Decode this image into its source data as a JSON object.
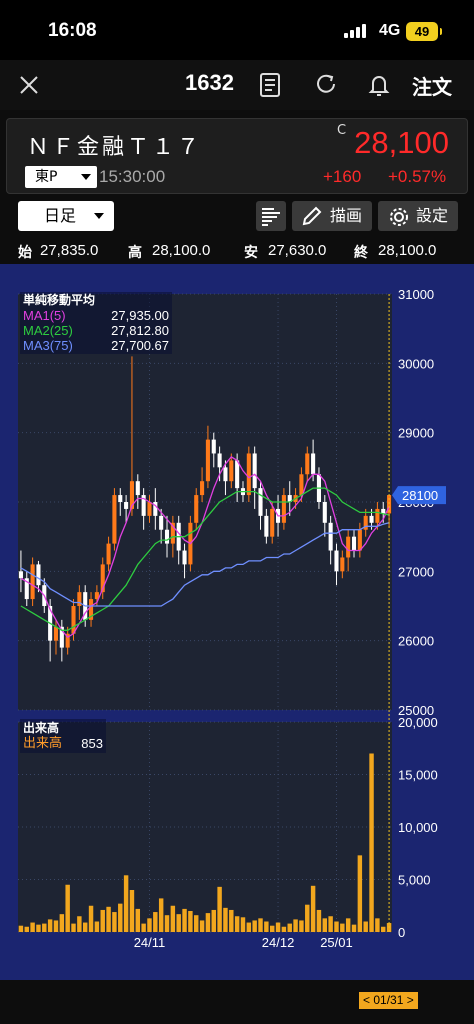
{
  "status_bar": {
    "time": "16:08",
    "network": "4G",
    "battery": "49"
  },
  "nav": {
    "ticker": "1632",
    "order_label": "注文"
  },
  "quote": {
    "name": "ＮＦ金融Ｔ１７",
    "market": "東P",
    "time": "15:30:00",
    "price_flag": "C",
    "price": "28,100",
    "change": "+160",
    "change_pct": "+0.57%"
  },
  "toolbar": {
    "period": "日足",
    "draw_label": "描画",
    "settings_label": "設定"
  },
  "ohlc": {
    "open_label": "始",
    "open": "27,835.0",
    "high_label": "高",
    "high": "28,100.0",
    "low_label": "安",
    "low": "27,630.0",
    "close_label": "終",
    "close": "28,100.0"
  },
  "price_legend": {
    "title": "単純移動平均",
    "items": [
      {
        "label": "MA1(5)",
        "value": "27,935.00",
        "color": "#e040e0"
      },
      {
        "label": "MA2(25)",
        "value": "27,812.80",
        "color": "#2ecc40"
      },
      {
        "label": "MA3(75)",
        "value": "27,700.67",
        "color": "#6f8fff"
      }
    ]
  },
  "volume_legend": {
    "title": "出来高",
    "label": "出来高",
    "value": "853"
  },
  "current_price_label": "28100",
  "current_date_label": "< 01/31 >",
  "colors": {
    "up": "#ff7a1a",
    "down": "#ffffff",
    "chart_bg": "#1b2570",
    "plot_bg": "#1e2433",
    "volume": "#f2a71e"
  },
  "chart_data": [
    {
      "type": "candlestick",
      "title": "単純移動平均",
      "y_ticks": [
        25000,
        26000,
        27000,
        28000,
        29000,
        30000,
        31000
      ],
      "y_tick_labels": [
        "25000",
        "26000",
        "27000",
        "28000",
        "29000",
        "30000",
        "31000"
      ],
      "ylim": [
        25000,
        31000
      ],
      "x_labels": [
        "24/11",
        "24/12",
        "25/01"
      ],
      "candles": [
        [
          27000,
          26900,
          27300,
          26700
        ],
        [
          26900,
          26600,
          27000,
          26500
        ],
        [
          26600,
          27100,
          27200,
          26500
        ],
        [
          27100,
          26800,
          27150,
          26700
        ],
        [
          26800,
          26500,
          26900,
          26400
        ],
        [
          26500,
          26000,
          26600,
          25700
        ],
        [
          26000,
          26200,
          26300,
          25800
        ],
        [
          26200,
          25900,
          26300,
          25700
        ],
        [
          25900,
          26100,
          26200,
          25800
        ],
        [
          26100,
          26500,
          26600,
          26000
        ],
        [
          26500,
          26700,
          26800,
          26300
        ],
        [
          26700,
          26300,
          26800,
          26200
        ],
        [
          26300,
          26600,
          26700,
          26200
        ],
        [
          26600,
          26700,
          26800,
          26500
        ],
        [
          26700,
          27100,
          27200,
          26600
        ],
        [
          27100,
          27400,
          27500,
          27000
        ],
        [
          27400,
          28100,
          28200,
          27300
        ],
        [
          28100,
          28000,
          28200,
          27800
        ],
        [
          28000,
          27900,
          28100,
          27700
        ],
        [
          27900,
          28300,
          30100,
          27800
        ],
        [
          28300,
          28100,
          28400,
          27900
        ],
        [
          28100,
          27800,
          28200,
          27600
        ],
        [
          27800,
          28000,
          28100,
          27700
        ],
        [
          28000,
          27800,
          28200,
          27600
        ],
        [
          27800,
          27600,
          27900,
          27400
        ],
        [
          27600,
          27400,
          27800,
          27200
        ],
        [
          27400,
          27700,
          27800,
          27200
        ],
        [
          27700,
          27300,
          27800,
          27100
        ],
        [
          27300,
          27100,
          27400,
          26900
        ],
        [
          27100,
          27700,
          27800,
          27000
        ],
        [
          27700,
          28100,
          28200,
          27600
        ],
        [
          28100,
          28300,
          28500,
          28000
        ],
        [
          28300,
          28900,
          29100,
          28200
        ],
        [
          28900,
          28700,
          29000,
          28500
        ],
        [
          28700,
          28500,
          28800,
          28300
        ],
        [
          28500,
          28300,
          28600,
          28100
        ],
        [
          28300,
          28600,
          28700,
          28200
        ],
        [
          28600,
          28200,
          28700,
          28000
        ],
        [
          28200,
          28100,
          28300,
          28000
        ],
        [
          28100,
          28700,
          28800,
          28000
        ],
        [
          28700,
          28200,
          28800,
          27900
        ],
        [
          28200,
          27800,
          28300,
          27600
        ],
        [
          27800,
          27500,
          27900,
          27400
        ],
        [
          27500,
          27900,
          28000,
          27400
        ],
        [
          27900,
          27700,
          28100,
          27500
        ],
        [
          27700,
          28100,
          28200,
          27600
        ],
        [
          28100,
          28000,
          28300,
          27800
        ],
        [
          28000,
          28100,
          28200,
          27900
        ],
        [
          28100,
          28400,
          28500,
          28000
        ],
        [
          28400,
          28700,
          28800,
          28300
        ],
        [
          28700,
          28400,
          28900,
          28300
        ],
        [
          28400,
          28000,
          28500,
          27900
        ],
        [
          28000,
          27700,
          28100,
          27500
        ],
        [
          27700,
          27300,
          27800,
          27100
        ],
        [
          27300,
          27000,
          27400,
          26800
        ],
        [
          27000,
          27200,
          27300,
          26900
        ],
        [
          27200,
          27500,
          27600,
          27000
        ],
        [
          27500,
          27300,
          27600,
          27200
        ],
        [
          27300,
          27600,
          27700,
          27200
        ],
        [
          27600,
          27800,
          27900,
          27500
        ],
        [
          27800,
          27700,
          27900,
          27600
        ],
        [
          27700,
          27900,
          28000,
          27600
        ],
        [
          27900,
          27835,
          28000,
          27700
        ],
        [
          27835,
          28100,
          28100,
          27630
        ]
      ],
      "series": [
        {
          "name": "MA1(5)",
          "color": "#e040e0",
          "values": [
            26900,
            26850,
            26800,
            26750,
            26650,
            26450,
            26300,
            26150,
            26050,
            26100,
            26250,
            26400,
            26500,
            26550,
            26750,
            26950,
            27200,
            27500,
            27700,
            27950,
            28050,
            28050,
            28000,
            27950,
            27850,
            27750,
            27650,
            27550,
            27450,
            27400,
            27500,
            27700,
            27950,
            28200,
            28400,
            28550,
            28650,
            28600,
            28450,
            28350,
            28400,
            28300,
            28100,
            27950,
            27800,
            27800,
            27850,
            27950,
            28050,
            28300,
            28400,
            28400,
            28300,
            28000,
            27700,
            27400,
            27300,
            27300,
            27300,
            27400,
            27550,
            27650,
            27750,
            27935
          ]
        },
        {
          "name": "MA2(25)",
          "color": "#2ecc40",
          "values": [
            26500,
            26450,
            26400,
            26350,
            26300,
            26250,
            26200,
            26150,
            26150,
            26200,
            26250,
            26300,
            26350,
            26400,
            26450,
            26500,
            26600,
            26700,
            26800,
            26950,
            27100,
            27200,
            27300,
            27400,
            27450,
            27450,
            27500,
            27500,
            27500,
            27550,
            27600,
            27700,
            27800,
            27900,
            28000,
            28050,
            28100,
            28150,
            28150,
            28150,
            28150,
            28100,
            28050,
            28000,
            28000,
            28000,
            28000,
            28050,
            28100,
            28150,
            28200,
            28200,
            28200,
            28150,
            28100,
            28000,
            27950,
            27900,
            27850,
            27850,
            27850,
            27850,
            27830,
            27812
          ]
        },
        {
          "name": "MA3(75)",
          "color": "#6f8fff",
          "values": [
            27050,
            27000,
            26950,
            26900,
            26850,
            26750,
            26700,
            26650,
            26600,
            26550,
            26550,
            26500,
            26500,
            26500,
            26500,
            26500,
            26500,
            26500,
            26500,
            26500,
            26500,
            26500,
            26500,
            26500,
            26500,
            26550,
            26600,
            26700,
            26800,
            26850,
            26900,
            26950,
            26950,
            27000,
            27000,
            27050,
            27050,
            27100,
            27100,
            27150,
            27150,
            27150,
            27200,
            27200,
            27200,
            27250,
            27250,
            27300,
            27350,
            27400,
            27450,
            27500,
            27550,
            27550,
            27550,
            27600,
            27600,
            27600,
            27600,
            27650,
            27650,
            27650,
            27680,
            27700
          ]
        }
      ]
    },
    {
      "type": "bar",
      "title": "出来高",
      "y_ticks": [
        0,
        5000,
        10000,
        15000,
        20000
      ],
      "y_tick_labels": [
        "0",
        "5,000",
        "10,000",
        "15,000",
        "20,000"
      ],
      "ylim": [
        0,
        20000
      ],
      "x_labels": [
        "24/11",
        "24/12",
        "25/01"
      ],
      "values": [
        600,
        500,
        900,
        700,
        800,
        1200,
        1100,
        1700,
        4500,
        800,
        1500,
        900,
        2500,
        1000,
        2100,
        2400,
        1900,
        2700,
        5400,
        4000,
        2200,
        800,
        1300,
        1900,
        3200,
        1600,
        2500,
        1700,
        2200,
        2000,
        1600,
        1100,
        1800,
        2100,
        4300,
        2300,
        2100,
        1500,
        1400,
        900,
        1100,
        1300,
        1000,
        600,
        900,
        500,
        800,
        1200,
        1100,
        2600,
        4400,
        2100,
        1300,
        1500,
        1000,
        800,
        1300,
        700,
        7300,
        1000,
        17000,
        1300,
        500,
        853
      ]
    }
  ]
}
